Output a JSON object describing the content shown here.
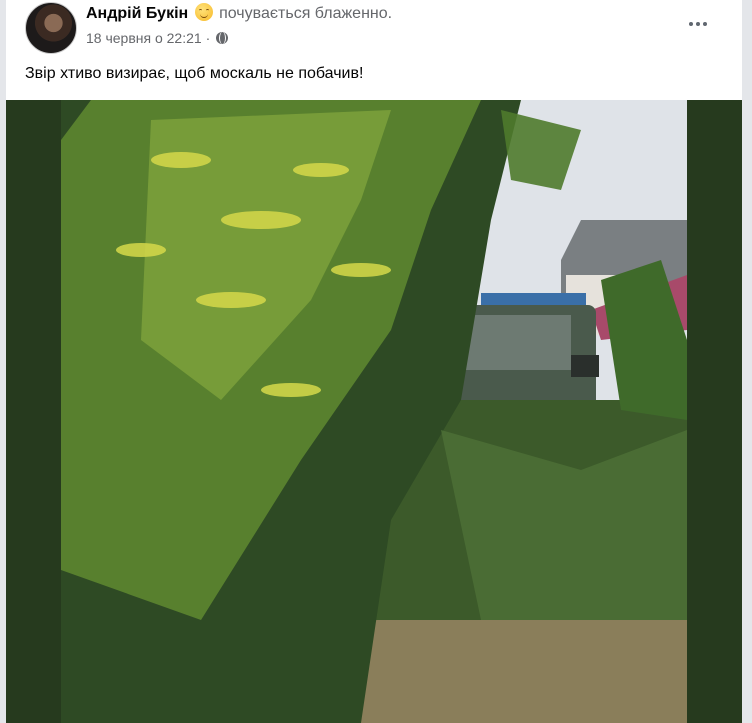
{
  "post": {
    "author": "Андрій Букін",
    "feeling_emoji": "smiling-face-icon",
    "feeling": "почувається блаженно.",
    "date": "18 червня о 22:21",
    "separator": "·",
    "privacy_icon": "globe-icon",
    "more_icon": "more-options-icon",
    "text": "Звір хтиво визирає, щоб москаль не побачив!"
  },
  "photo": {
    "subject": "photo",
    "colors": {
      "frame": "#263a1e",
      "sky": "#dfe3e8",
      "foliage_dark": "#2e4a24",
      "foliage_light": "#7fa23c",
      "flowers": "#d6d94a",
      "car_body": "#4a5a4c",
      "roof": "#7a7f82",
      "pink_roof": "#a84a6a",
      "blue_fence": "#3a6fa8",
      "dry_grass": "#8a7e5a"
    }
  }
}
